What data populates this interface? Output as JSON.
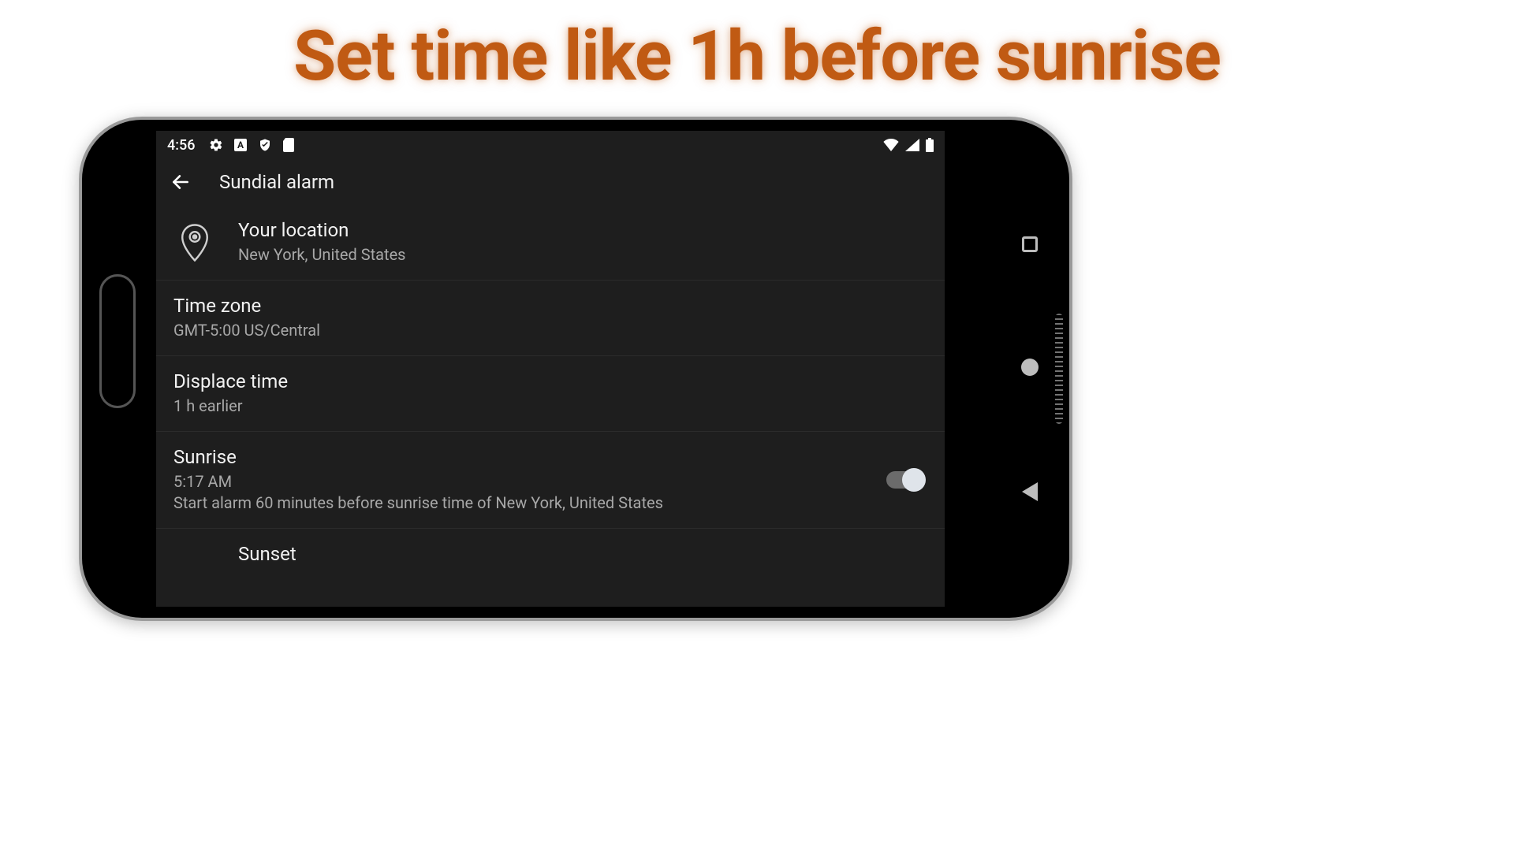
{
  "headline": "Set time like 1h before sunrise",
  "status": {
    "time": "4:56"
  },
  "appbar": {
    "title": "Sundial alarm"
  },
  "rows": {
    "location": {
      "title": "Your location",
      "value": "New York, United States"
    },
    "timezone": {
      "title": "Time zone",
      "value": "GMT-5:00 US/Central"
    },
    "displace": {
      "title": "Displace time",
      "value": "1 h earlier"
    },
    "sunrise": {
      "title": "Sunrise",
      "time": "5:17 AM",
      "desc": "Start alarm 60 minutes before sunrise time of New York, United States",
      "enabled": true
    },
    "sunset": {
      "title": "Sunset"
    }
  }
}
